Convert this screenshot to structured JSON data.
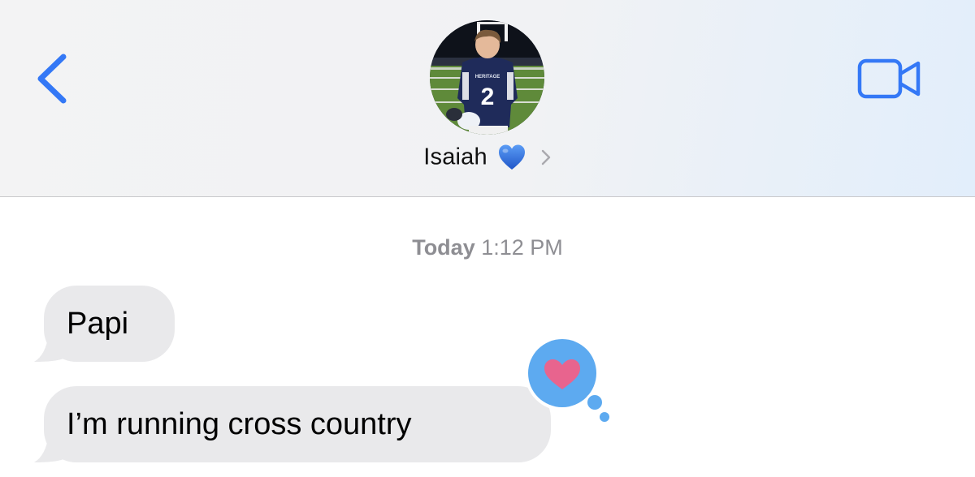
{
  "header": {
    "back_icon": "chevron-left-icon",
    "video_icon": "video-camera-icon",
    "contact": {
      "name": "Isaiah",
      "emoji": "blue-heart-icon",
      "chevron_icon": "chevron-right-icon",
      "avatar_number": "2",
      "avatar_jersey_text": "HERITAGE"
    }
  },
  "conversation": {
    "timestamp_day": "Today",
    "timestamp_time": "1:12 PM",
    "messages": [
      {
        "text": "Papi",
        "direction": "incoming"
      },
      {
        "text": "I’m running cross country",
        "direction": "incoming",
        "reaction": "heart"
      }
    ]
  },
  "colors": {
    "accent": "#3478f6",
    "bubble_incoming": "#e9e9eb",
    "timestamp": "#8e8e93",
    "tapback_bg": "#5daaf0",
    "tapback_heart": "#e8648e",
    "blue_heart": "#2f6fe0"
  }
}
